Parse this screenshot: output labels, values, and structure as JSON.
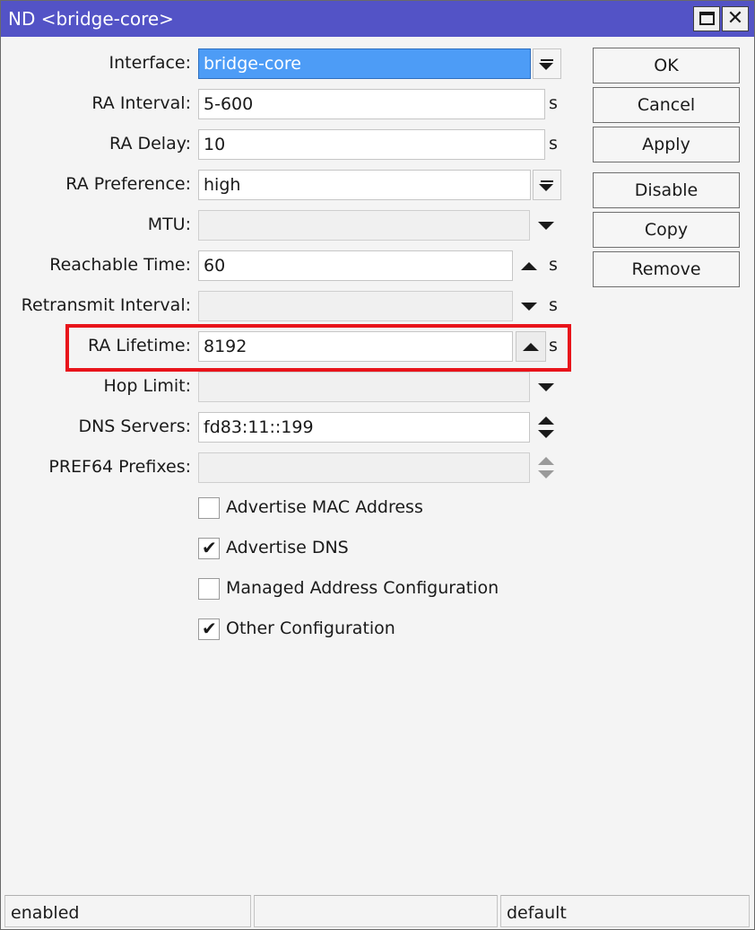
{
  "window": {
    "title": "ND <bridge-core>",
    "maximize_icon": "maximize-icon",
    "close_label": "✕"
  },
  "form": {
    "interface": {
      "label": "Interface:",
      "value": "bridge-core"
    },
    "ra_interval": {
      "label": "RA Interval:",
      "value": "5-600",
      "unit": "s"
    },
    "ra_delay": {
      "label": "RA Delay:",
      "value": "10",
      "unit": "s"
    },
    "ra_preference": {
      "label": "RA Preference:",
      "value": "high"
    },
    "mtu": {
      "label": "MTU:",
      "value": ""
    },
    "reachable_time": {
      "label": "Reachable Time:",
      "value": "60",
      "unit": "s"
    },
    "retransmit_interval": {
      "label": "Retransmit Interval:",
      "value": "",
      "unit": "s"
    },
    "ra_lifetime": {
      "label": "RA Lifetime:",
      "value": "8192",
      "unit": "s"
    },
    "hop_limit": {
      "label": "Hop Limit:",
      "value": ""
    },
    "dns_servers": {
      "label": "DNS Servers:",
      "value": "fd83:11::199"
    },
    "pref64_prefixes": {
      "label": "PREF64 Prefixes:",
      "value": ""
    }
  },
  "checkboxes": [
    {
      "label": "Advertise MAC Address",
      "checked": false
    },
    {
      "label": "Advertise DNS",
      "checked": true
    },
    {
      "label": "Managed Address Configuration",
      "checked": false
    },
    {
      "label": "Other Configuration",
      "checked": true
    }
  ],
  "buttons": {
    "ok": "OK",
    "cancel": "Cancel",
    "apply": "Apply",
    "disable": "Disable",
    "copy": "Copy",
    "remove": "Remove"
  },
  "status_bar": {
    "left": "enabled",
    "middle": "",
    "right": "default"
  },
  "colors": {
    "title_bar": "#5353c6",
    "highlight_border": "#e8141b",
    "selected_field": "#4d9cf6"
  }
}
